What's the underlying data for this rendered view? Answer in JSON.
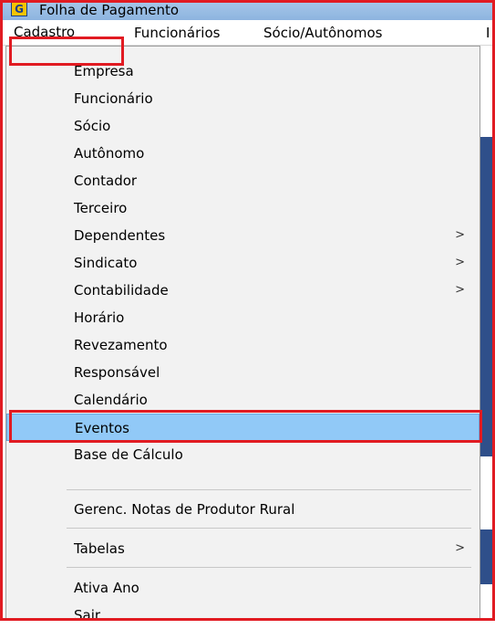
{
  "window": {
    "title": "Folha de Pagamento",
    "icon": "app-logo-icon",
    "icon_glyph": "G"
  },
  "menubar": {
    "items": [
      "Cadastro",
      "Funcionários",
      "Sócio/Autônomos",
      "I"
    ],
    "active": "Cadastro"
  },
  "menu": {
    "groups": [
      [
        {
          "label": "Empresa"
        },
        {
          "label": "Funcionário"
        },
        {
          "label": "Sócio"
        },
        {
          "label": "Autônomo"
        },
        {
          "label": "Contador"
        },
        {
          "label": "Terceiro"
        },
        {
          "label": "Dependentes",
          "submenu": ">"
        },
        {
          "label": "Sindicato",
          "submenu": ">"
        },
        {
          "label": "Contabilidade",
          "submenu": ">"
        },
        {
          "label": "Horário"
        },
        {
          "label": "Revezamento"
        },
        {
          "label": "Responsável"
        },
        {
          "label": "Calendário"
        },
        {
          "label": "Eventos",
          "selected": true
        },
        {
          "label": "Base de Cálculo"
        }
      ],
      [
        {
          "label": "Gerenc. Notas de Produtor Rural"
        }
      ],
      [
        {
          "label": "Tabelas",
          "submenu": ">"
        }
      ],
      [
        {
          "label": "Ativa Ano"
        },
        {
          "label": "Sair"
        }
      ]
    ]
  },
  "colors": {
    "titlebar": "#8db4df",
    "menu_background": "#f2f2f2",
    "selected_item": "#91c9f7",
    "highlight_outline": "#e11b22"
  }
}
